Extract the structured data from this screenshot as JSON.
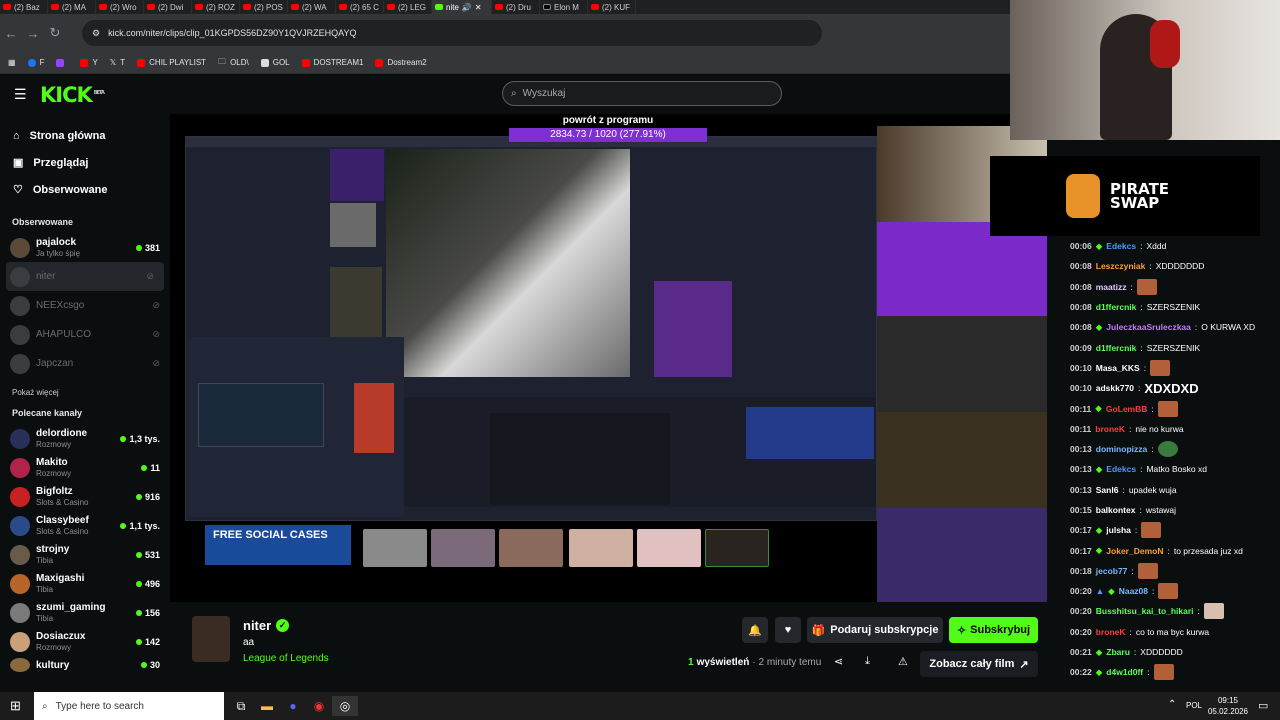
{
  "browser": {
    "tabs": [
      {
        "label": "(2) Baz"
      },
      {
        "label": "(2) MA"
      },
      {
        "label": "(2) Wro"
      },
      {
        "label": "(2) Dwi"
      },
      {
        "label": "(2) ROZ"
      },
      {
        "label": "(2) POS"
      },
      {
        "label": "(2) WA"
      },
      {
        "label": "(2) 65 C"
      },
      {
        "label": "(2) LEG"
      },
      {
        "label": "nite",
        "active": true
      },
      {
        "label": "(2) Dru"
      },
      {
        "label": "Elon M"
      },
      {
        "label": "(2) KUF"
      }
    ],
    "url": "kick.com/niter/clips/clip_01KGPDS56DZ90Y1QVJRZEHQAYQ",
    "bookmarks": [
      "F",
      "",
      "Y",
      "T",
      "CHIL PLAYLIST",
      "OLD\\",
      "GOL",
      "DOSTREAM1",
      "Dostream2"
    ]
  },
  "header": {
    "logo": "KICK",
    "logo_beta": "BETA",
    "search_placeholder": "Wyszukaj"
  },
  "sidebar": {
    "nav": [
      {
        "label": "Strona główna",
        "icon": "home-icon"
      },
      {
        "label": "Przeglądaj",
        "icon": "browse-icon"
      },
      {
        "label": "Obserwowane",
        "icon": "heart-icon"
      }
    ],
    "following_title": "Obserwowane",
    "following": [
      {
        "name": "pajalock",
        "category": "Ja tylko śpię",
        "viewers": "381",
        "live": true
      },
      {
        "name": "niter",
        "live": false,
        "selected": true
      },
      {
        "name": "NEEXcsgo",
        "live": false
      },
      {
        "name": "AHAPULCO",
        "live": false
      },
      {
        "name": "Japczan",
        "live": false
      }
    ],
    "show_more": "Pokaż więcej",
    "recommended_title": "Polecane kanały",
    "recommended": [
      {
        "name": "delordione",
        "category": "Rozmowy",
        "viewers": "1,3 tys."
      },
      {
        "name": "Makito",
        "category": "Rozmowy",
        "viewers": "11"
      },
      {
        "name": "Bigfoltz",
        "category": "Slots & Casino",
        "viewers": "916"
      },
      {
        "name": "Classybeef",
        "category": "Slots & Casino",
        "viewers": "1,1 tys."
      },
      {
        "name": "strojny",
        "category": "Tibia",
        "viewers": "531"
      },
      {
        "name": "Maxigashi",
        "category": "Tibia",
        "viewers": "496"
      },
      {
        "name": "szumi_gaming",
        "category": "Tibia",
        "viewers": "156"
      },
      {
        "name": "Dosiaczux",
        "category": "Rozmowy",
        "viewers": "142"
      },
      {
        "name": "kultury",
        "category": "",
        "viewers": "30"
      }
    ]
  },
  "player": {
    "overlay_title": "powrót z programu",
    "overlay_progress": "2834.73 / 1020 (277.91%)",
    "progress_fraction": 1.0,
    "sponsor": "PIRATE SWAP",
    "promo": "FREE SOCIAL CASES"
  },
  "clip": {
    "streamer": "niter",
    "title": "aa",
    "category": "League of Legends",
    "views_count": "1",
    "views_label": "wyświetleń",
    "time_ago": "· 2 minuty temu",
    "gift_button": "Podaruj subskrypcje",
    "subscribe_button": "Subskrybuj",
    "watch_full_button": "Zobacz cały film"
  },
  "chat": {
    "messages": [
      {
        "time": "00:06",
        "user": "Edekcs",
        "color": "#4a9bff",
        "text": "Xddd"
      },
      {
        "time": "00:08",
        "user": "Leszczyniak",
        "color": "#ff9d2e",
        "text": "XDDDDDDD"
      },
      {
        "time": "00:08",
        "user": "maatizz",
        "color": "#e8c6ff",
        "text": "",
        "emote": true
      },
      {
        "time": "00:08",
        "user": "d1ffercnik",
        "color": "#5eff5a",
        "text": "SZERSZENIK"
      },
      {
        "time": "00:08",
        "user": "JuleczkaaSruleczkaa",
        "color": "#c27bff",
        "text": "O KURWA XD"
      },
      {
        "time": "00:09",
        "user": "d1ffercnik",
        "color": "#5eff5a",
        "text": "SZERSZENIK"
      },
      {
        "time": "00:10",
        "user": "Masa_KKS",
        "color": "#ffffff",
        "text": "",
        "emote": true
      },
      {
        "time": "00:10",
        "user": "adskk770",
        "color": "#ffffff",
        "text": "XDXDXD"
      },
      {
        "time": "00:11",
        "user": "GoLemBB",
        "color": "#ff3b3b",
        "text": "",
        "emote": true
      },
      {
        "time": "00:11",
        "user": "broneK",
        "color": "#ff3b3b",
        "text": "nie no kurwa"
      },
      {
        "time": "00:13",
        "user": "dominopizza",
        "color": "#7ab8ff",
        "text": "",
        "emote": true
      },
      {
        "time": "00:13",
        "user": "Edekcs",
        "color": "#4a9bff",
        "text": "Matko Bosko xd"
      },
      {
        "time": "00:13",
        "user": "Sanl6",
        "color": "#ffffff",
        "text": "upadek wuja"
      },
      {
        "time": "00:15",
        "user": "balkontex",
        "color": "#ffffff",
        "text": "wstawaj"
      },
      {
        "time": "00:17",
        "user": "julsha",
        "color": "#ffffff",
        "text": "",
        "emote": true
      },
      {
        "time": "00:17",
        "user": "Joker_DemoN",
        "color": "#ff9d2e",
        "text": "to przesada juz xd"
      },
      {
        "time": "00:18",
        "user": "jecob77",
        "color": "#7ab8ff",
        "text": "",
        "emote": true
      },
      {
        "time": "00:20",
        "user": "Naaz08",
        "color": "#7ab8ff",
        "text": "",
        "emote": true
      },
      {
        "time": "00:20",
        "user": "Busshitsu_kai_to_hikari",
        "color": "#5eff5a",
        "text": "",
        "emote": true
      },
      {
        "time": "00:20",
        "user": "broneK",
        "color": "#ff3b3b",
        "text": "co to ma byc kurwa"
      },
      {
        "time": "00:21",
        "user": "Zbaru",
        "color": "#5eff5a",
        "text": "XDDDDDD"
      },
      {
        "time": "00:22",
        "user": "d4w1d0ff",
        "color": "#5eff5a",
        "text": "",
        "emote": true
      }
    ]
  },
  "taskbar": {
    "search_placeholder": "Type here to search",
    "lang": "POL",
    "time": "09:15",
    "date": "05.02.2026"
  }
}
